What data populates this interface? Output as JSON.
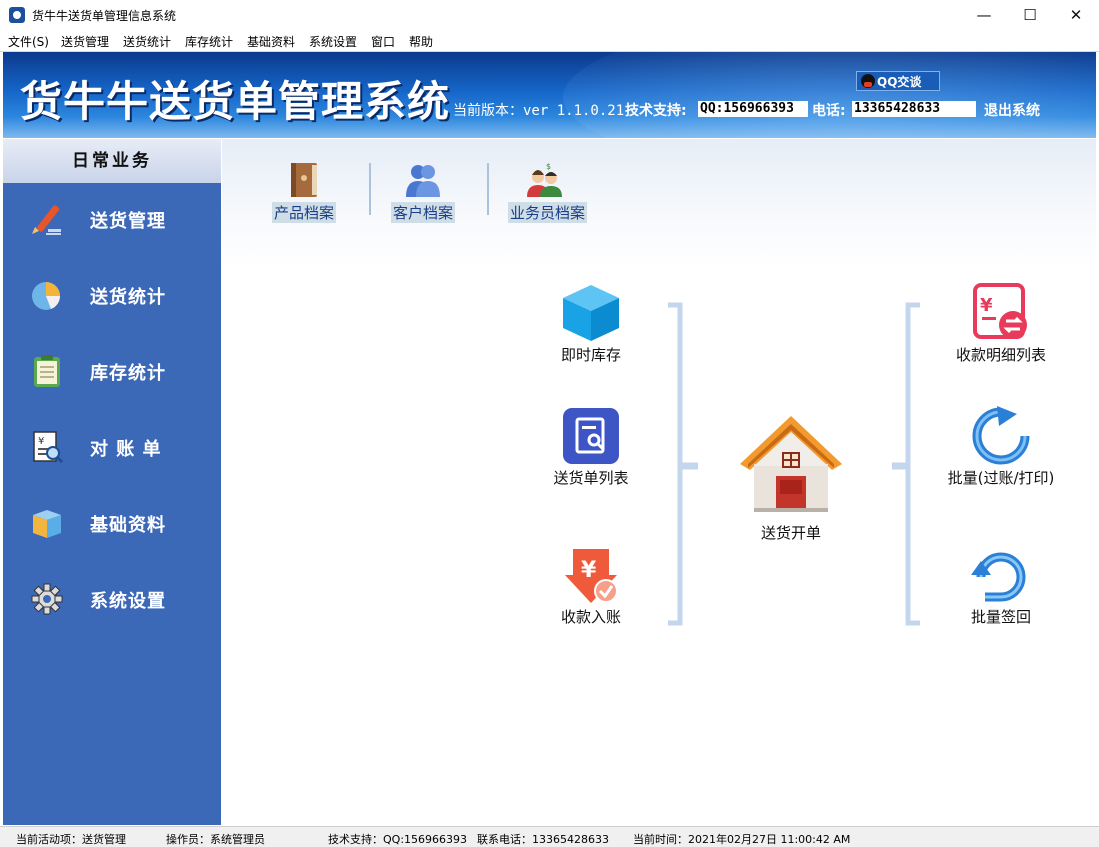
{
  "window": {
    "title": "货牛牛送货单管理信息系统",
    "min_glyph": "—",
    "max_glyph": "☐",
    "close_glyph": "✕"
  },
  "menu": [
    "文件(S)",
    "送货管理",
    "送货统计",
    "库存统计",
    "基础资料",
    "系统设置",
    "窗口",
    "帮助"
  ],
  "banner": {
    "title": "货牛牛送货单管理系统",
    "qq_chat_label": "QQ交谈",
    "version_label": "当前版本：ver 1.1.0.21",
    "support_label": "技术支持:",
    "qq_value": "QQ:156966393",
    "phone_label": "电话:",
    "phone_value": "13365428633",
    "exit_label": "退出系统"
  },
  "sidebar": {
    "header": "日常业务",
    "items": [
      {
        "label": "送货管理",
        "icon": "pencil-icon"
      },
      {
        "label": "送货统计",
        "icon": "pie-chart-icon"
      },
      {
        "label": "库存统计",
        "icon": "clipboard-icon"
      },
      {
        "label": "对 账 单",
        "icon": "statement-search-icon"
      },
      {
        "label": "基础资料",
        "icon": "box-icon"
      },
      {
        "label": "系统设置",
        "icon": "gear-icon"
      }
    ]
  },
  "toolbar": {
    "product_archive": "产品档案",
    "customer_archive": "客户档案",
    "salesman_archive": "业务员档案"
  },
  "flow": {
    "realtime_stock": "即时库存",
    "delivery_list": "送货单列表",
    "payment_entry": "收款入账",
    "create_delivery": "送货开单",
    "payment_detail": "收款明细列表",
    "batch_post_print": "批量(过账/打印)",
    "batch_signback": "批量签回"
  },
  "status": {
    "active_item": "当前活动项：送货管理",
    "operator": "操作员：系统管理员",
    "support": "技术支持：QQ:156966393",
    "phone": "联系电话：13365428633",
    "time": "当前时间：2021年02月27日 11:00:42 AM"
  },
  "colors": {
    "sidebar_bg": "#3c68b8",
    "banner_blue": "#1565c8",
    "accent_orange": "#e9692c",
    "bracket_blue": "#c3d6ee"
  }
}
